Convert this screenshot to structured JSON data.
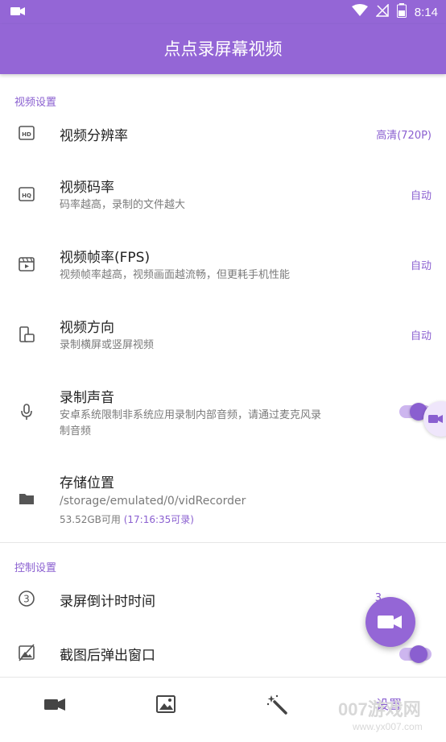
{
  "status_bar": {
    "time": "8:14"
  },
  "app_bar": {
    "title": "点点录屏幕视频"
  },
  "video_section": {
    "header": "视频设置",
    "resolution": {
      "title": "视频分辨率",
      "value": "高清(720P)"
    },
    "bitrate": {
      "title": "视频码率",
      "subtitle": "码率越高，录制的文件越大",
      "value": "自动"
    },
    "framerate": {
      "title": "视频帧率(FPS)",
      "subtitle": "视频帧率越高，视频画面越流畅，但更耗手机性能",
      "value": "自动"
    },
    "orientation": {
      "title": "视频方向",
      "subtitle": "录制横屏或竖屏视频",
      "value": "自动"
    },
    "audio": {
      "title": "录制声音",
      "subtitle_line1": "安卓系统限制非系统应用录制内部音频，请通过麦克风录",
      "subtitle_line2": "制音频",
      "enabled": true
    },
    "storage": {
      "title": "存储位置",
      "path": "/storage/emulated/0/vidRecorder",
      "free": "53.52GB可用",
      "duration": "(17:16:35可录)"
    }
  },
  "control_section": {
    "header": "控制设置",
    "countdown": {
      "title": "录屏倒计时时间",
      "value": "3"
    },
    "screenshot_popup": {
      "title": "截图后弹出窗口",
      "enabled": true
    }
  },
  "bottom_nav": {
    "items": [
      {
        "icon": "video-camera-icon"
      },
      {
        "icon": "image-icon"
      },
      {
        "icon": "magic-wand-icon"
      },
      {
        "label": "设置"
      }
    ]
  },
  "watermark": {
    "line1": "007游戏网",
    "line2": "www.yx007.com"
  },
  "colors": {
    "primary": "#9466d6",
    "accent": "#8a5fd0"
  }
}
